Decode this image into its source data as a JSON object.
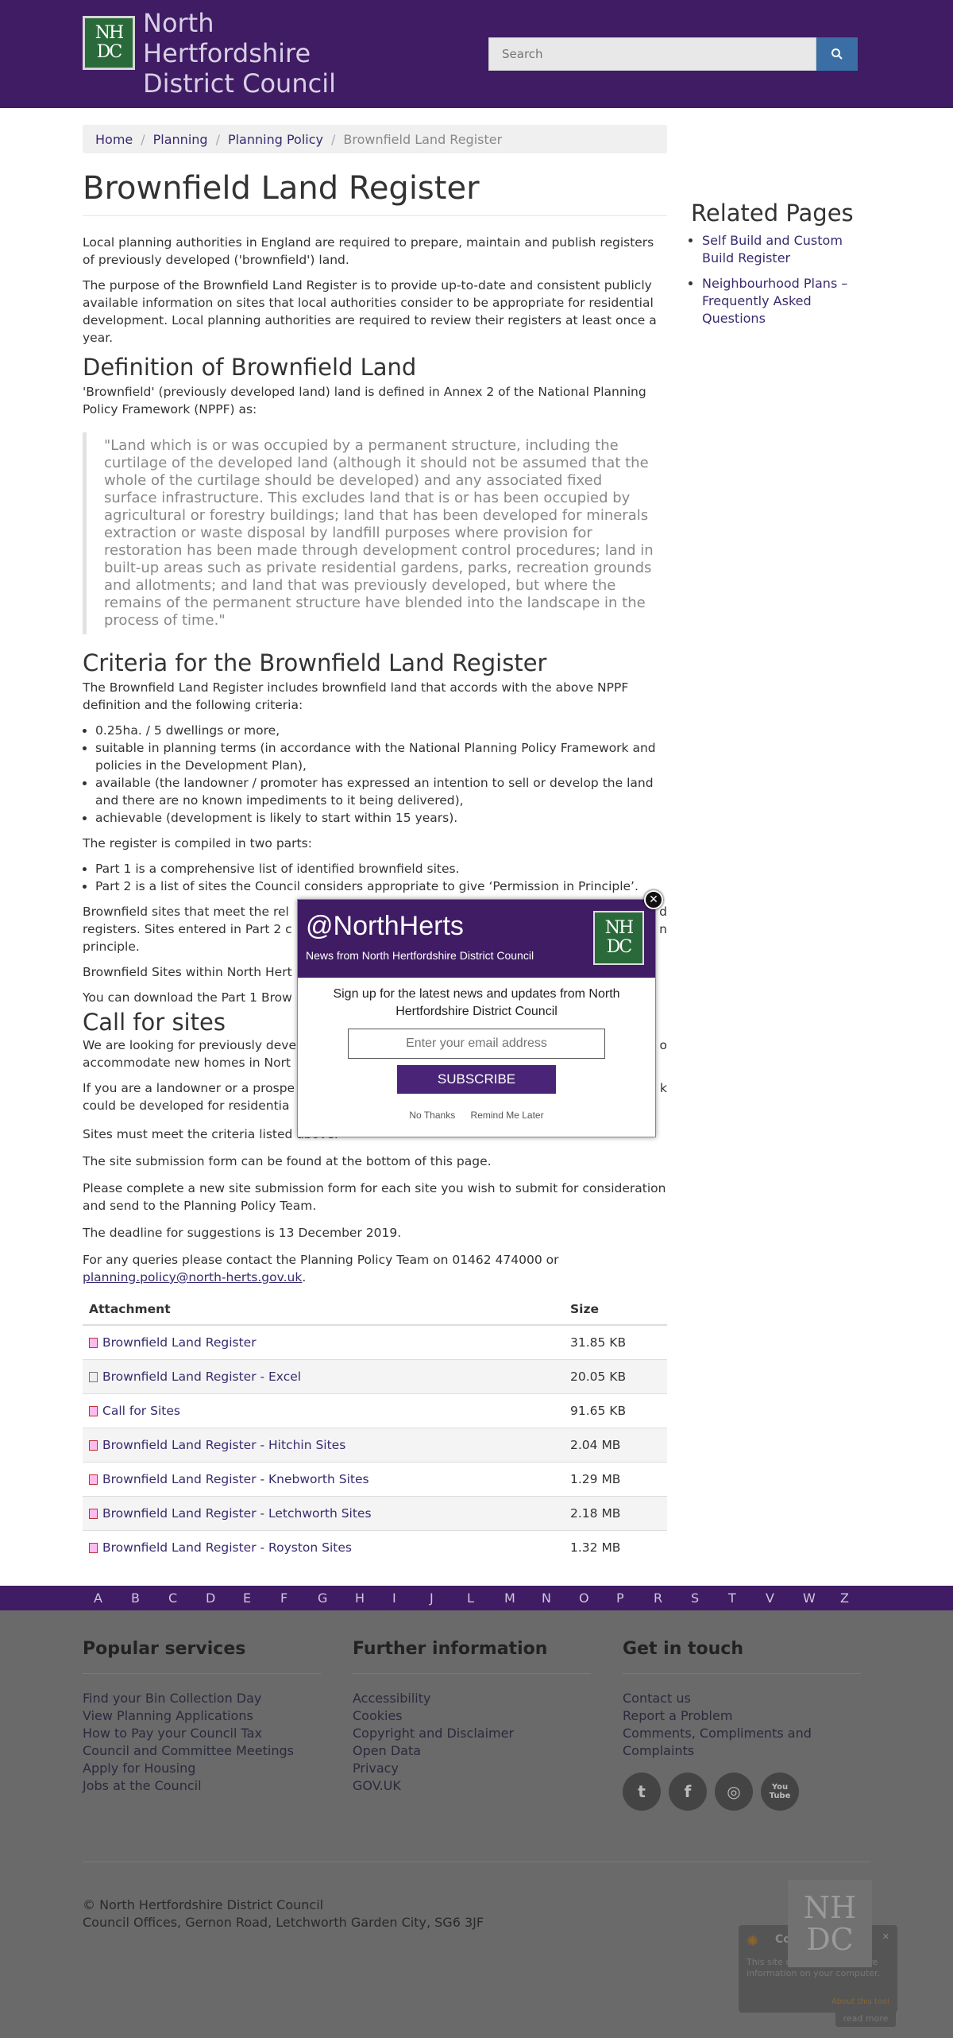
{
  "header": {
    "logo_letters": "NH DC",
    "site_name": "North Hertfordshire District Council",
    "search_placeholder": "Search"
  },
  "breadcrumb": {
    "items": [
      "Home",
      "Planning",
      "Planning Policy"
    ],
    "current": "Brownfield Land Register"
  },
  "main": {
    "title": "Brownfield Land Register",
    "intro_1": "Local planning authorities in England are required to prepare, maintain and publish registers of previously developed ('brownfield') land.",
    "intro_2": "The purpose of the Brownfield Land Register is to provide up-to-date and consistent publicly available information on sites that local authorities consider to be appropriate for residential development. Local planning authorities are required to review their registers at least once a year.",
    "definition_heading": "Definition of Brownfield Land",
    "definition_text": "'Brownfield' (previously developed land) land is defined in Annex 2 of the National Planning Policy Framework (NPPF) as:",
    "quote": "\"Land which is or was occupied by a permanent structure, including the curtilage of the developed land (although it should not be assumed that the whole of the curtilage should be developed) and any associated fixed surface infrastructure. This excludes land that is or has been occupied by agricultural or forestry buildings; land that has been developed for minerals extraction or waste disposal by landfill purposes where provision for restoration has been made through development control procedures; land in built-up areas such as private residential gardens, parks, recreation grounds and allotments; and land that was previously developed, but where the remains of the permanent structure have blended into the landscape in the process of time.\"",
    "criteria_heading": "Criteria for the Brownfield Land Register",
    "criteria_text": "The Brownfield Land Register includes brownfield land that accords with the above NPPF definition and the following criteria:",
    "criteria_list": [
      "0.25ha. / 5 dwellings or more,",
      "suitable in planning terms (in accordance with the National Planning Policy Framework and policies in the Development Plan),",
      "available (the landowner / promoter has expressed an intention to sell or develop the land and there are no known impediments to it being delivered),",
      "achievable (development is likely to start within 15 years)."
    ],
    "parts_text": "The register is compiled in two parts:",
    "parts_list": [
      "Part 1 is a comprehensive list of identified brownfield sites.",
      "Part 2 is a list of sites the Council considers appropriate to give ‘Permission in Principle’."
    ],
    "p_sites_a": "Brownfield sites that meet the rel",
    "p_sites_a_end": "d",
    "p_sites_b": "registers. Sites entered in Part 2 c",
    "p_sites_b_end": "n",
    "p_sites_c": "principle.",
    "p_within": "Brownfield Sites within North Hert",
    "p_download": "You can download the Part 1 Brow",
    "call_heading": "Call for sites",
    "call_a": "We are looking for previously deve",
    "call_a_end": "o",
    "call_b": "accommodate new homes in Nort",
    "landowner_a": "If you are a landowner or a prospe",
    "landowner_a_end": "k",
    "landowner_b": "could be developed for residentia",
    "p_criteria": "Sites must meet the criteria listed above.",
    "p_form": "The site submission form can be found at the bottom of this page.",
    "p_complete": "Please complete a new site submission form for each site you wish to submit for consideration and send to the Planning Policy Team.",
    "p_deadline": "The deadline for suggestions is 13 December 2019.",
    "p_queries": "For any queries please contact the Planning Policy Team on 01462 474000 or",
    "email": "planning.policy@north-herts.gov.uk",
    "period": "."
  },
  "attachments": {
    "col_attachment": "Attachment",
    "col_size": "Size",
    "rows": [
      {
        "name": "Brownfield Land Register",
        "size": "31.85 KB",
        "icon": "pdf-icon"
      },
      {
        "name": "Brownfield Land Register - Excel",
        "size": "20.05 KB",
        "icon": "spreadsheet-icon"
      },
      {
        "name": "Call for Sites",
        "size": "91.65 KB",
        "icon": "pdf-icon"
      },
      {
        "name": "Brownfield Land Register - Hitchin Sites",
        "size": "2.04 MB",
        "icon": "pdf-icon"
      },
      {
        "name": "Brownfield Land Register - Knebworth Sites",
        "size": "1.29 MB",
        "icon": "pdf-icon"
      },
      {
        "name": "Brownfield Land Register - Letchworth Sites",
        "size": "2.18 MB",
        "icon": "pdf-icon"
      },
      {
        "name": "Brownfield Land Register - Royston Sites",
        "size": "1.32 MB",
        "icon": "pdf-icon"
      }
    ]
  },
  "sidebar": {
    "heading": "Related Pages",
    "links": [
      "Self Build and Custom Build Register",
      "Neighbourhood Plans – Frequently Asked Questions"
    ]
  },
  "az": [
    "A",
    "B",
    "C",
    "D",
    "E",
    "F",
    "G",
    "H",
    "I",
    "J",
    "L",
    "M",
    "N",
    "O",
    "P",
    "R",
    "S",
    "T",
    "V",
    "W",
    "Z"
  ],
  "footer": {
    "popular_heading": "Popular services",
    "popular": [
      "Find your Bin Collection Day",
      "View Planning Applications",
      "How to Pay your Council Tax",
      "Council and Committee Meetings",
      "Apply for Housing",
      "Jobs at the Council"
    ],
    "further_heading": "Further information",
    "further": [
      "Accessibility",
      "Cookies",
      "Copyright and Disclaimer",
      "Open Data",
      "Privacy",
      "GOV.UK"
    ],
    "contact_heading": "Get in touch",
    "contact": [
      "Contact us",
      "Report a Problem",
      "Comments, Compliments and Complaints"
    ],
    "social": [
      "twitter-icon",
      "facebook-icon",
      "instagram-icon",
      "youtube-icon"
    ],
    "social_glyphs": [
      "t",
      "f",
      "◎",
      "You Tube"
    ],
    "copyright": "© North Hertfordshire District Council",
    "address": "Council Offices, Gernon Road, Letchworth Garden City, SG6 3JF"
  },
  "cookie": {
    "title": "Cookie Control",
    "text": "This site uses cookies to store information on your computer.",
    "about": "About this tool",
    "read_more": "read more",
    "close": "✕",
    "logo_letters": "NH DC"
  },
  "popup": {
    "handle": "@NorthHerts",
    "tagline": "News from North Hertfordshire District Council",
    "logo_letters": "NH DC",
    "signup_text": "Sign up for the latest news and updates from North Hertfordshire District Council",
    "email_placeholder": "Enter your email address",
    "subscribe": "SUBSCRIBE",
    "no_thanks": "No Thanks",
    "remind": "Remind Me Later",
    "close": "✕"
  },
  "colors": {
    "brand_purple": "#3f1c63",
    "search_blue": "#3a6ea5",
    "logo_green": "#2a6a3a"
  }
}
